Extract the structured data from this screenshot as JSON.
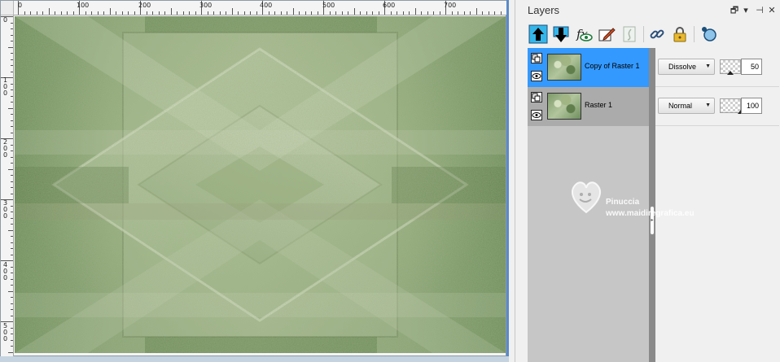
{
  "canvas": {
    "h_ruler_labels": [
      "0",
      "100",
      "200",
      "300",
      "400",
      "500",
      "600",
      "700"
    ],
    "v_ruler_labels": [
      "0",
      "1\n0\n0",
      "2\n0\n0",
      "3\n0\n0",
      "4\n0\n0",
      "5\n0\n0"
    ]
  },
  "layers_palette": {
    "title": "Layers",
    "title_buttons": {
      "restore": "🗗",
      "menu": "▾",
      "pin": "⊣",
      "close": "✕"
    },
    "toolbar": [
      "move-layer-up-icon",
      "move-layer-down-icon",
      "visibility-toggle-icon",
      "edit-icon",
      "mask-icon",
      "link-icon",
      "lock-icon",
      "properties-icon"
    ],
    "layers": [
      {
        "name": "Copy of Raster 1",
        "blend_mode": "Dissolve",
        "opacity": "50",
        "opacity_fraction": 0.5,
        "active": true
      },
      {
        "name": "Raster 1",
        "blend_mode": "Normal",
        "opacity": "100",
        "opacity_fraction": 1.0,
        "active": false
      }
    ],
    "watermark": {
      "name": "Pinuccia",
      "url": "www.maidiregrafica.eu"
    }
  },
  "colors": {
    "active_layer": "#3399ff",
    "inactive_layer": "#ababab",
    "canvas_window_border": "#5a8ac8"
  }
}
